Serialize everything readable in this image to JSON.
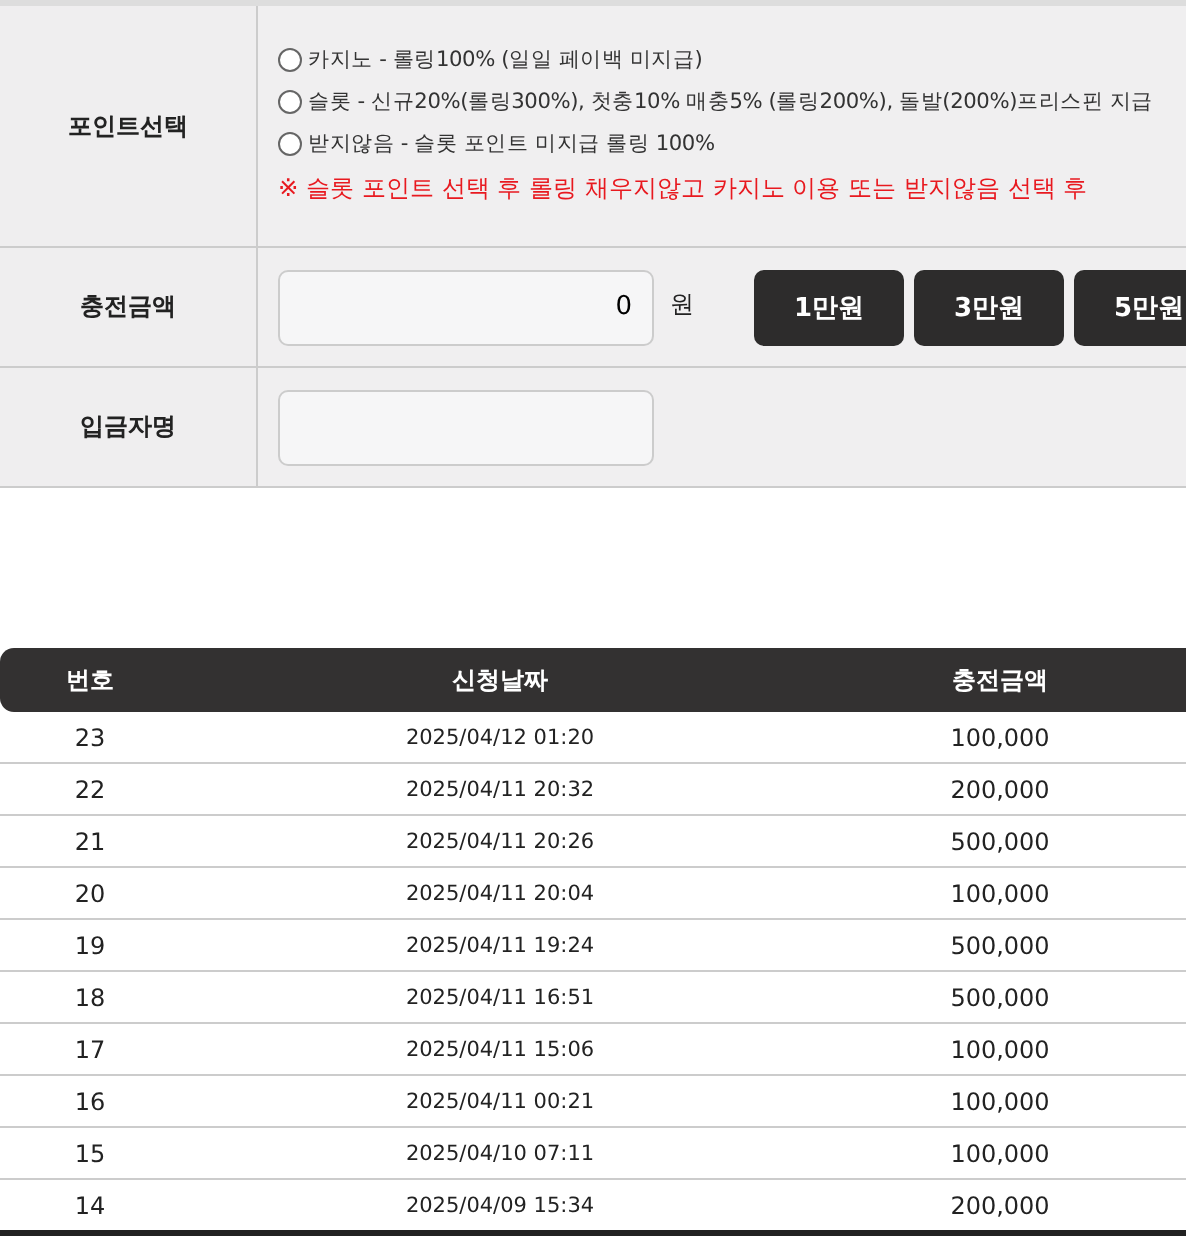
{
  "form": {
    "point_select": {
      "label": "포인트선택",
      "options": [
        {
          "label": "카지노 - 롤링100% (일일 페이백 미지급)",
          "selected": false
        },
        {
          "label": "슬롯 - 신규20%(롤링300%), 첫충10% 매충5% (롤링200%), 돌발(200%)프리스핀 지급",
          "selected": false
        },
        {
          "label": "받지않음 - 슬롯 포인트 미지급 롤링 100%",
          "selected": false
        }
      ],
      "notice": "※ 슬롯 포인트 선택 후 롤링 채우지않고 카지노 이용 또는 받지않음 선택 후"
    },
    "amount": {
      "label": "충전금액",
      "value": "0",
      "unit": "원",
      "presets": [
        "1만원",
        "3만원",
        "5만원"
      ]
    },
    "depositor": {
      "label": "입금자명"
    }
  },
  "table": {
    "columns": [
      "번호",
      "신청날짜",
      "충전금액"
    ],
    "rows": [
      [
        "23",
        "2025/04/12 01:20",
        "100,000"
      ],
      [
        "22",
        "2025/04/11 20:32",
        "200,000"
      ],
      [
        "21",
        "2025/04/11 20:26",
        "500,000"
      ],
      [
        "20",
        "2025/04/11 20:04",
        "100,000"
      ],
      [
        "19",
        "2025/04/11 19:24",
        "500,000"
      ],
      [
        "18",
        "2025/04/11 16:51",
        "500,000"
      ],
      [
        "17",
        "2025/04/11 15:06",
        "100,000"
      ],
      [
        "16",
        "2025/04/11 00:21",
        "100,000"
      ],
      [
        "15",
        "2025/04/10 07:11",
        "100,000"
      ],
      [
        "14",
        "2025/04/09 15:34",
        "200,000"
      ]
    ]
  }
}
